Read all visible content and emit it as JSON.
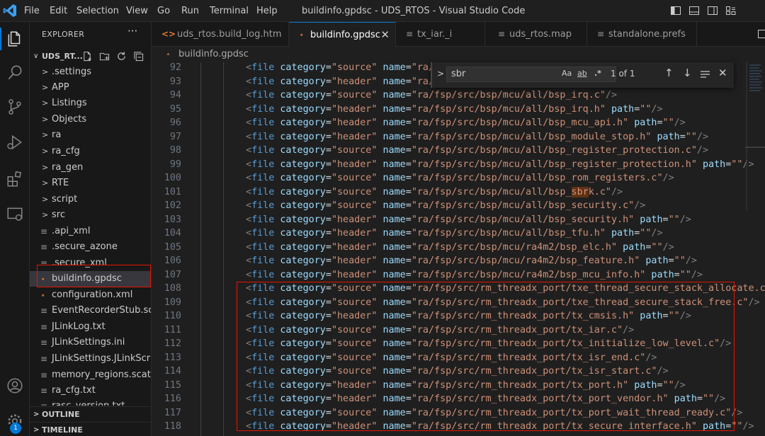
{
  "window": {
    "title": "buildinfo.gpdsc - UDS_RTOS - Visual Studio Code"
  },
  "menu": [
    "File",
    "Edit",
    "Selection",
    "View",
    "Go",
    "Run",
    "Terminal",
    "Help"
  ],
  "activity": {
    "badge": "1"
  },
  "sidebar": {
    "title": "EXPLORER",
    "more": "···",
    "project": "UDS_RT...",
    "items": [
      {
        "type": "folder",
        "label": ".settings"
      },
      {
        "type": "folder",
        "label": "APP"
      },
      {
        "type": "folder",
        "label": "Listings"
      },
      {
        "type": "folder",
        "label": "Objects"
      },
      {
        "type": "folder",
        "label": "ra"
      },
      {
        "type": "folder",
        "label": "ra_cfg"
      },
      {
        "type": "folder",
        "label": "ra_gen"
      },
      {
        "type": "folder",
        "label": "RTE"
      },
      {
        "type": "folder",
        "label": "script"
      },
      {
        "type": "folder",
        "label": "src"
      },
      {
        "type": "file",
        "icon": "lines",
        "label": ".api_xml"
      },
      {
        "type": "file",
        "icon": "lines",
        "label": ".secure_azone"
      },
      {
        "type": "file",
        "icon": "lines",
        "label": ".secure_xml"
      },
      {
        "type": "file",
        "icon": "rss",
        "label": "buildinfo.gpdsc",
        "selected": true
      },
      {
        "type": "file",
        "icon": "rss",
        "label": "configuration.xml"
      },
      {
        "type": "file",
        "icon": "lines",
        "label": "EventRecorderStub.sc..."
      },
      {
        "type": "file",
        "icon": "lines",
        "label": "JLinkLog.txt"
      },
      {
        "type": "file",
        "icon": "lines",
        "label": "JLinkSettings.ini"
      },
      {
        "type": "file",
        "icon": "lines",
        "label": "JLinkSettings.JLinkScri..."
      },
      {
        "type": "file",
        "icon": "lines",
        "label": "memory_regions.scat"
      },
      {
        "type": "file",
        "icon": "lines",
        "label": "ra_cfg.txt"
      },
      {
        "type": "file",
        "icon": "lines",
        "label": "rasc_version.txt"
      }
    ],
    "outline": "OUTLINE",
    "timeline": "TIMELINE"
  },
  "tabs": [
    {
      "icon": "html",
      "label": "uds_rtos.build_log.htm"
    },
    {
      "icon": "rss",
      "label": "buildinfo.gpdsc",
      "active": true,
      "close": "✕"
    },
    {
      "icon": "lines",
      "label": "tx_iar._i"
    },
    {
      "icon": "lines",
      "label": "uds_rtos.map"
    },
    {
      "icon": "lines",
      "label": "standalone.prefs"
    }
  ],
  "breadcrumb": {
    "label": "buildinfo.gpdsc"
  },
  "find": {
    "value": "sbr",
    "match_case": "Aa",
    "whole_word": "ab",
    "regex": ".*",
    "count": "1 of 1"
  },
  "editor": {
    "lines": [
      {
        "n": "92",
        "cat": "source",
        "name": "ra/",
        "path": null
      },
      {
        "n": "93",
        "cat": "header",
        "name": "ra/",
        "path": null
      },
      {
        "n": "94",
        "cat": "source",
        "name": "ra/fsp/src/bsp/mcu/all/bsp_irq.c",
        "path": null
      },
      {
        "n": "95",
        "cat": "header",
        "name": "ra/fsp/src/bsp/mcu/all/bsp_irq.h",
        "path": ""
      },
      {
        "n": "96",
        "cat": "header",
        "name": "ra/fsp/src/bsp/mcu/all/bsp_mcu_api.h",
        "path": ""
      },
      {
        "n": "97",
        "cat": "header",
        "name": "ra/fsp/src/bsp/mcu/all/bsp_module_stop.h",
        "path": ""
      },
      {
        "n": "98",
        "cat": "source",
        "name": "ra/fsp/src/bsp/mcu/all/bsp_register_protection.c",
        "path": null
      },
      {
        "n": "99",
        "cat": "header",
        "name": "ra/fsp/src/bsp/mcu/all/bsp_register_protection.h",
        "path": ""
      },
      {
        "n": "100",
        "cat": "source",
        "name": "ra/fsp/src/bsp/mcu/all/bsp_rom_registers.c",
        "path": null
      },
      {
        "n": "101",
        "cat": "source",
        "name": "ra/fsp/src/bsp/mcu/all/bsp_sbrk.c",
        "path": null,
        "highlight": "sbr"
      },
      {
        "n": "102",
        "cat": "source",
        "name": "ra/fsp/src/bsp/mcu/all/bsp_security.c",
        "path": null
      },
      {
        "n": "103",
        "cat": "header",
        "name": "ra/fsp/src/bsp/mcu/all/bsp_security.h",
        "path": ""
      },
      {
        "n": "104",
        "cat": "header",
        "name": "ra/fsp/src/bsp/mcu/all/bsp_tfu.h",
        "path": ""
      },
      {
        "n": "105",
        "cat": "header",
        "name": "ra/fsp/src/bsp/mcu/ra4m2/bsp_elc.h",
        "path": ""
      },
      {
        "n": "106",
        "cat": "header",
        "name": "ra/fsp/src/bsp/mcu/ra4m2/bsp_feature.h",
        "path": ""
      },
      {
        "n": "107",
        "cat": "header",
        "name": "ra/fsp/src/bsp/mcu/ra4m2/bsp_mcu_info.h",
        "path": ""
      },
      {
        "n": "108",
        "cat": "source",
        "name": "ra/fsp/src/rm_threadx_port/txe_thread_secure_stack_allocate.c",
        "path": null
      },
      {
        "n": "109",
        "cat": "source",
        "name": "ra/fsp/src/rm_threadx_port/txe_thread_secure_stack_free.c",
        "path": null
      },
      {
        "n": "110",
        "cat": "header",
        "name": "ra/fsp/src/rm_threadx_port/tx_cmsis.h",
        "path": ""
      },
      {
        "n": "111",
        "cat": "source",
        "name": "ra/fsp/src/rm_threadx_port/tx_iar.c",
        "path": null
      },
      {
        "n": "112",
        "cat": "source",
        "name": "ra/fsp/src/rm_threadx_port/tx_initialize_low_level.c",
        "path": null
      },
      {
        "n": "113",
        "cat": "source",
        "name": "ra/fsp/src/rm_threadx_port/tx_isr_end.c",
        "path": null
      },
      {
        "n": "114",
        "cat": "source",
        "name": "ra/fsp/src/rm_threadx_port/tx_isr_start.c",
        "path": null
      },
      {
        "n": "115",
        "cat": "header",
        "name": "ra/fsp/src/rm_threadx_port/tx_port.h",
        "path": ""
      },
      {
        "n": "116",
        "cat": "header",
        "name": "ra/fsp/src/rm_threadx_port/tx_port_vendor.h",
        "path": ""
      },
      {
        "n": "117",
        "cat": "source",
        "name": "ra/fsp/src/rm_threadx_port/tx_port_wait_thread_ready.c",
        "path": null
      },
      {
        "n": "118",
        "cat": "header",
        "name": "ra/fsp/src/rm_threadx_port/tx_secure_interface.h",
        "path": ""
      }
    ]
  }
}
